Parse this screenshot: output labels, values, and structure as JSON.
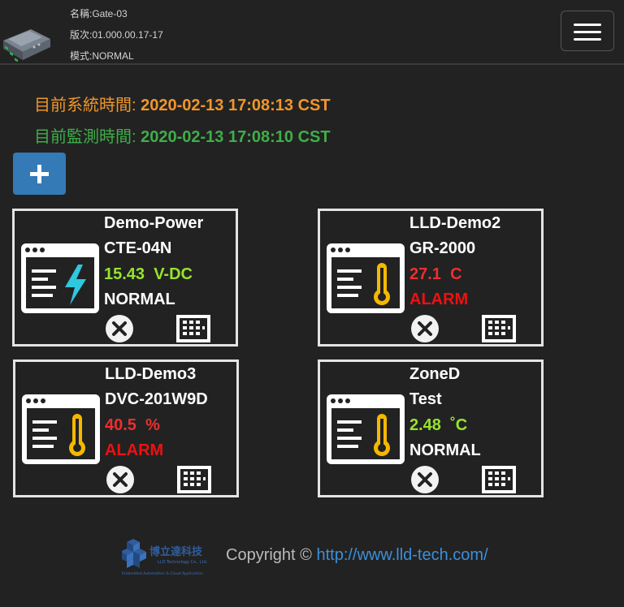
{
  "device": {
    "name": "名稱:Gate-03",
    "version": "版次:01.000.00.17-17",
    "mode": "模式:NORMAL"
  },
  "times": {
    "system_label": "目前系統時間:",
    "system_value": "2020-02-13 17:08:13 CST",
    "monitor_label": "目前監測時間:",
    "monitor_value": "2020-02-13 17:08:10 CST"
  },
  "cards": [
    {
      "name": "Demo-Power",
      "model": "CTE-04N",
      "value": "15.43",
      "unit": "V-DC",
      "status": "NORMAL",
      "icon": "power-bolt-icon"
    },
    {
      "name": "LLD-Demo2",
      "model": "GR-2000",
      "value": "27.1",
      "unit": "C",
      "status": "ALARM",
      "icon": "thermometer-icon"
    },
    {
      "name": "LLD-Demo3",
      "model": "DVC-201W9D",
      "value": "40.5",
      "unit": "%",
      "status": "ALARM",
      "icon": "thermometer-icon"
    },
    {
      "name": "ZoneD",
      "model": "Test",
      "value": "2.48",
      "unit": "˚C",
      "status": "NORMAL",
      "icon": "thermometer-icon"
    }
  ],
  "footer": {
    "logo_text": "博立達科技",
    "logo_sub": "LLD Technology Co., Ltd.",
    "logo_tagline": "Embedded Automation & Cloud Application",
    "copyright": "Copyright ©",
    "link": "http://www.lld-tech.com/"
  },
  "colors": {
    "accent_blue": "#337ab7",
    "system_time": "#f0962a",
    "monitor_time": "#3fae49",
    "value_normal": "#96e52c",
    "value_alarm": "#ee2e2e",
    "thermometer": "#f5b800",
    "bolt": "#2ec8e0"
  }
}
